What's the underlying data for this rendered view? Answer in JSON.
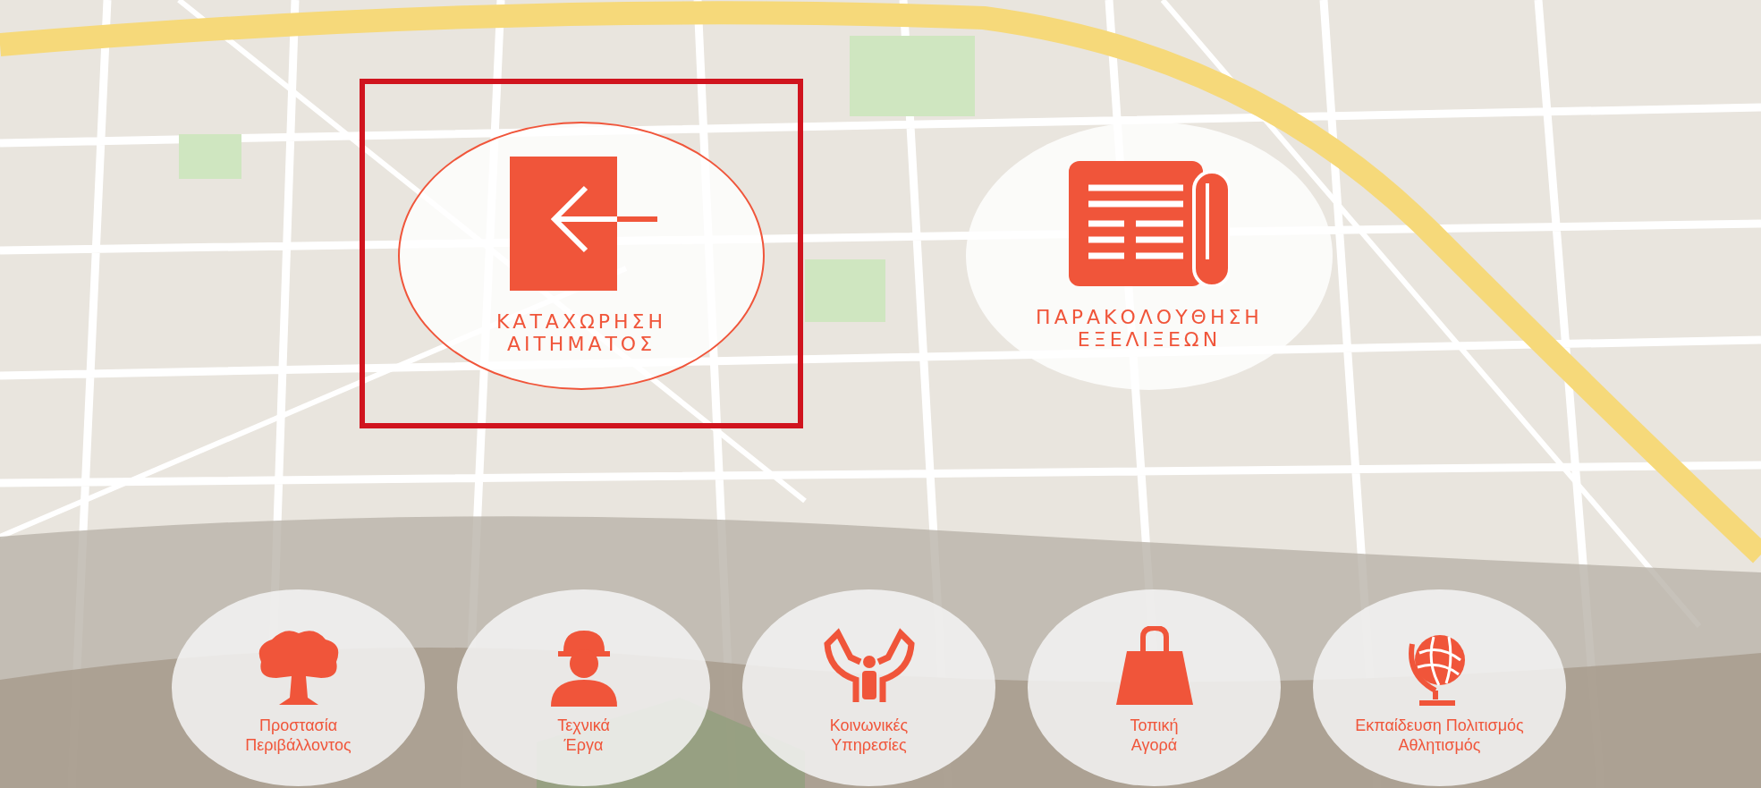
{
  "main_actions": [
    {
      "kind": "new-request",
      "label": "ΚΑΤΑΧΩΡΗΣΗ\nΑΙΤΗΜΑΤΟΣ",
      "selected": true
    },
    {
      "kind": "track",
      "label": "ΠΑΡΑΚΟΛΟΥΘΗΣΗ\nΕΞΕΛΙΞΕΩΝ",
      "selected": false
    }
  ],
  "categories": [
    {
      "kind": "tree",
      "label": "Προστασία\nΠεριβάλλοντος"
    },
    {
      "kind": "worker",
      "label": "Τεχνικά\nΈργα"
    },
    {
      "kind": "care",
      "label": "Κοινωνικές\nΥπηρεσίες"
    },
    {
      "kind": "bag",
      "label": "Τοπική\nΑγορά"
    },
    {
      "kind": "globe",
      "label": "Εκπαίδευση Πολιτισμός\nΑθλητισμός"
    }
  ]
}
